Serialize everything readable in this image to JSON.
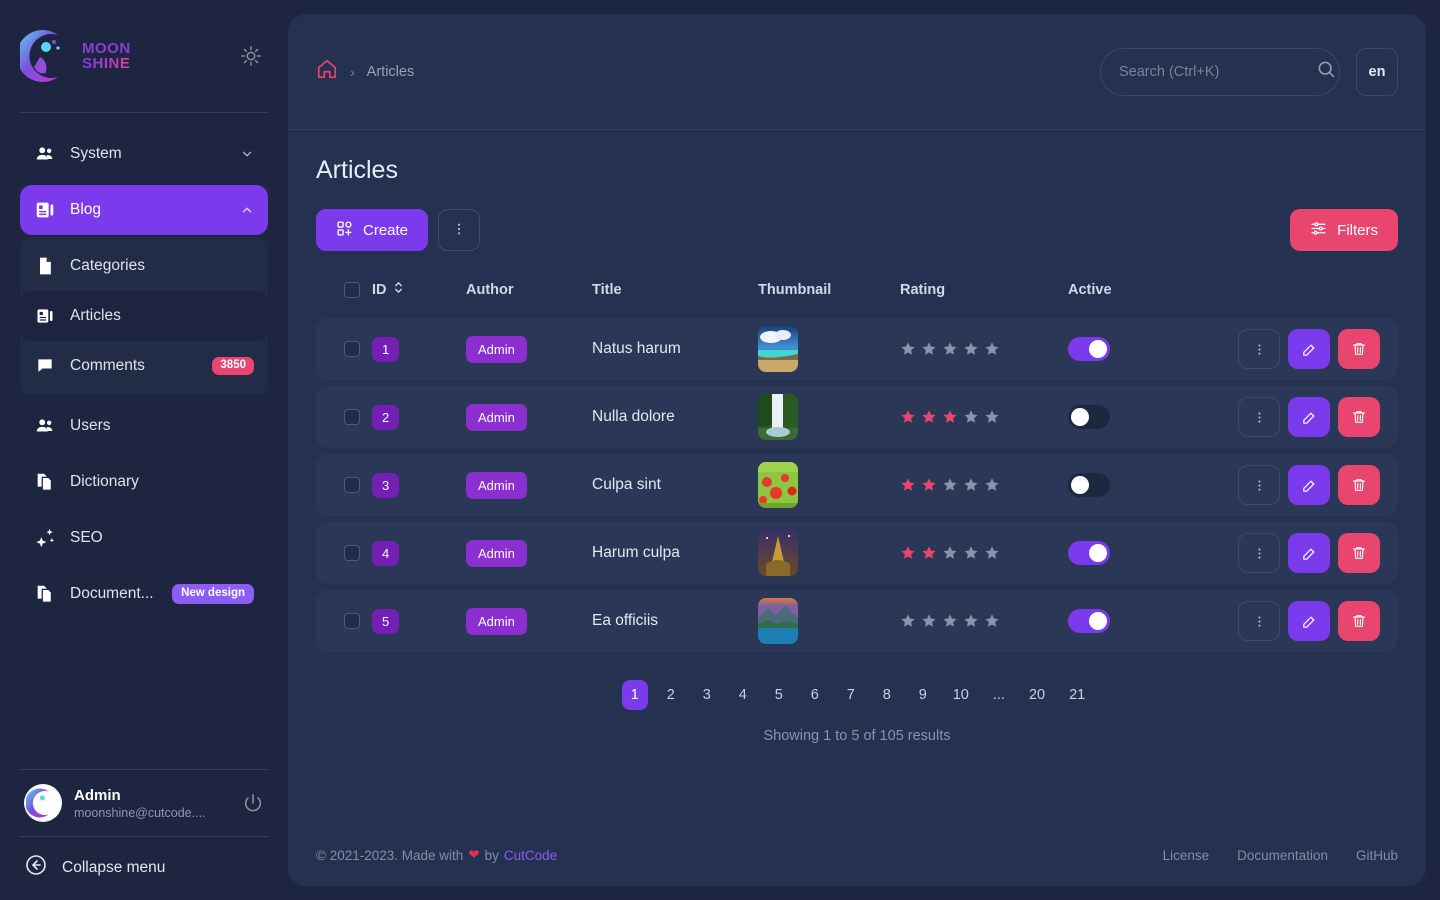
{
  "brand": {
    "logo_line1": "MOON",
    "logo_line2": "SHINE",
    "theme_toggle_icon": "sun-icon"
  },
  "sidebar": {
    "items": [
      {
        "label": "System",
        "icon": "users-group-icon",
        "state": "collapsed",
        "chevron": "chevron-down-icon"
      },
      {
        "label": "Blog",
        "icon": "blog-icon",
        "state": "active-expanded",
        "chevron": "chevron-up-icon"
      },
      {
        "label": "Users",
        "icon": "users-group-icon"
      },
      {
        "label": "Dictionary",
        "icon": "copy-documents-icon"
      },
      {
        "label": "SEO",
        "icon": "sparkles-icon"
      },
      {
        "label": "Document...",
        "icon": "copy-documents-icon",
        "badge": "New design"
      }
    ],
    "submenu": [
      {
        "label": "Categories",
        "icon": "document-icon"
      },
      {
        "label": "Articles",
        "icon": "blog-icon",
        "selected": true
      },
      {
        "label": "Comments",
        "icon": "comment-icon",
        "badge": "3850"
      }
    ],
    "user": {
      "name": "Admin",
      "email": "moonshine@cutcode....",
      "avatar": "moon-avatar",
      "logout_icon": "power-icon"
    },
    "collapse": {
      "label": "Collapse menu",
      "icon": "arrow-left-circle-icon"
    }
  },
  "topbar": {
    "breadcrumb": {
      "home_icon": "home-icon",
      "separator": "›",
      "current": "Articles"
    },
    "search": {
      "placeholder": "Search (Ctrl+K)",
      "value": "",
      "icon": "search-icon"
    },
    "language": "en"
  },
  "page": {
    "title": "Articles",
    "create_label": "Create",
    "create_icon": "grid-plus-icon",
    "more_icon": "vertical-dots-icon",
    "filters_label": "Filters",
    "filters_icon": "sliders-icon"
  },
  "table": {
    "columns": [
      "",
      "ID",
      "Author",
      "Title",
      "Thumbnail",
      "Rating",
      "Active"
    ],
    "sort_icon": "sort-updown-icon",
    "rows": [
      {
        "id": "1",
        "author": "Admin",
        "title": "Natus harum",
        "thumb": "beach",
        "rating": 0,
        "active": true
      },
      {
        "id": "2",
        "author": "Admin",
        "title": "Nulla dolore",
        "thumb": "waterfall",
        "rating": 3,
        "active": false
      },
      {
        "id": "3",
        "author": "Admin",
        "title": "Culpa sint",
        "thumb": "poppies",
        "rating": 2,
        "active": false
      },
      {
        "id": "4",
        "author": "Admin",
        "title": "Harum culpa",
        "thumb": "eiffel",
        "rating": 2,
        "active": true
      },
      {
        "id": "5",
        "author": "Admin",
        "title": "Ea officiis",
        "thumb": "lake",
        "rating": 0,
        "active": true
      }
    ],
    "rating_max": 5,
    "row_actions": [
      "vertical-dots-icon",
      "edit-pencil-icon",
      "trash-icon"
    ]
  },
  "pagination": {
    "pages": [
      "1",
      "2",
      "3",
      "4",
      "5",
      "6",
      "7",
      "8",
      "9",
      "10",
      "...",
      "20",
      "21"
    ],
    "current": "1",
    "showing": "Showing 1 to 5 of 105 results"
  },
  "footer": {
    "copyright_pre": "© 2021-2023. Made with",
    "heart": "❤",
    "copyright_mid": "by",
    "brand": "CutCode",
    "links": [
      "License",
      "Documentation",
      "GitHub"
    ]
  },
  "colors": {
    "background": "#1d2540",
    "panel": "#253151",
    "row": "#2b3757",
    "accent_purple": "#7c3aed",
    "accent_pink": "#e8456f",
    "id_pill": "#7520b5",
    "author_pill": "#8b2fd0",
    "star_filled": "#e8456f",
    "star_empty": "#8b93a9"
  }
}
